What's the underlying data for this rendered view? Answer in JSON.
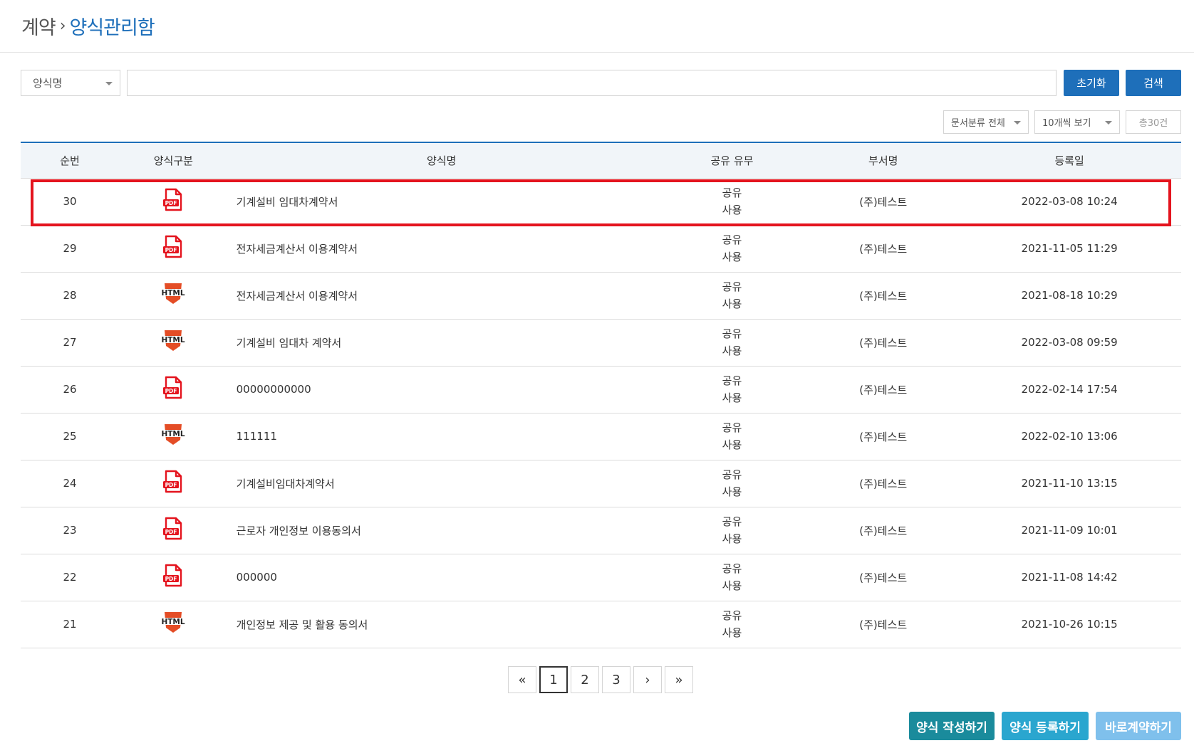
{
  "breadcrumb": {
    "root": "계약",
    "separator": "›",
    "current": "양식관리함"
  },
  "search": {
    "field_select": "양식명",
    "input_value": "",
    "reset_label": "초기화",
    "search_label": "검색"
  },
  "filters": {
    "category": "문서분류 전체",
    "page_size": "10개씩 보기",
    "total": "총30건"
  },
  "table": {
    "headers": {
      "no": "순번",
      "type": "양식구분",
      "name": "양식명",
      "share": "공유 유무",
      "dept": "부서명",
      "date": "등록일"
    },
    "rows": [
      {
        "no": "30",
        "type": "PDF",
        "name": "기계설비 임대차계약서",
        "share1": "공유",
        "share2": "사용",
        "dept": "(주)테스트",
        "date": "2022-03-08 10:24"
      },
      {
        "no": "29",
        "type": "PDF",
        "name": "전자세금계산서 이용계약서",
        "share1": "공유",
        "share2": "사용",
        "dept": "(주)테스트",
        "date": "2021-11-05 11:29"
      },
      {
        "no": "28",
        "type": "HTML",
        "name": "전자세금계산서 이용계약서",
        "share1": "공유",
        "share2": "사용",
        "dept": "(주)테스트",
        "date": "2021-08-18 10:29"
      },
      {
        "no": "27",
        "type": "HTML",
        "name": "기계설비 임대차 계약서",
        "share1": "공유",
        "share2": "사용",
        "dept": "(주)테스트",
        "date": "2022-03-08 09:59"
      },
      {
        "no": "26",
        "type": "PDF",
        "name": "00000000000",
        "share1": "공유",
        "share2": "사용",
        "dept": "(주)테스트",
        "date": "2022-02-14 17:54"
      },
      {
        "no": "25",
        "type": "HTML",
        "name": "111111",
        "share1": "공유",
        "share2": "사용",
        "dept": "(주)테스트",
        "date": "2022-02-10 13:06"
      },
      {
        "no": "24",
        "type": "PDF",
        "name": "기계설비임대차계약서",
        "share1": "공유",
        "share2": "사용",
        "dept": "(주)테스트",
        "date": "2021-11-10 13:15"
      },
      {
        "no": "23",
        "type": "PDF",
        "name": "근로자 개인정보 이용동의서",
        "share1": "공유",
        "share2": "사용",
        "dept": "(주)테스트",
        "date": "2021-11-09 10:01"
      },
      {
        "no": "22",
        "type": "PDF",
        "name": "000000",
        "share1": "공유",
        "share2": "사용",
        "dept": "(주)테스트",
        "date": "2021-11-08 14:42"
      },
      {
        "no": "21",
        "type": "HTML",
        "name": "개인정보 제공 및 활용 동의서",
        "share1": "공유",
        "share2": "사용",
        "dept": "(주)테스트",
        "date": "2021-10-26 10:15"
      }
    ]
  },
  "pagination": {
    "first": "«",
    "pages": [
      "1",
      "2",
      "3"
    ],
    "next": "›",
    "last": "»",
    "current": "1"
  },
  "actions": {
    "write": "양식 작성하기",
    "register": "양식 등록하기",
    "direct": "바로계약하기"
  },
  "icons": {
    "pdf": "pdf-file-icon",
    "html": "html5-icon",
    "caret": "caret-down-icon"
  },
  "colors": {
    "accent": "#1e6fba",
    "highlight": "#e4141e",
    "pdf": "#e4141e",
    "html": "#e44d26"
  }
}
